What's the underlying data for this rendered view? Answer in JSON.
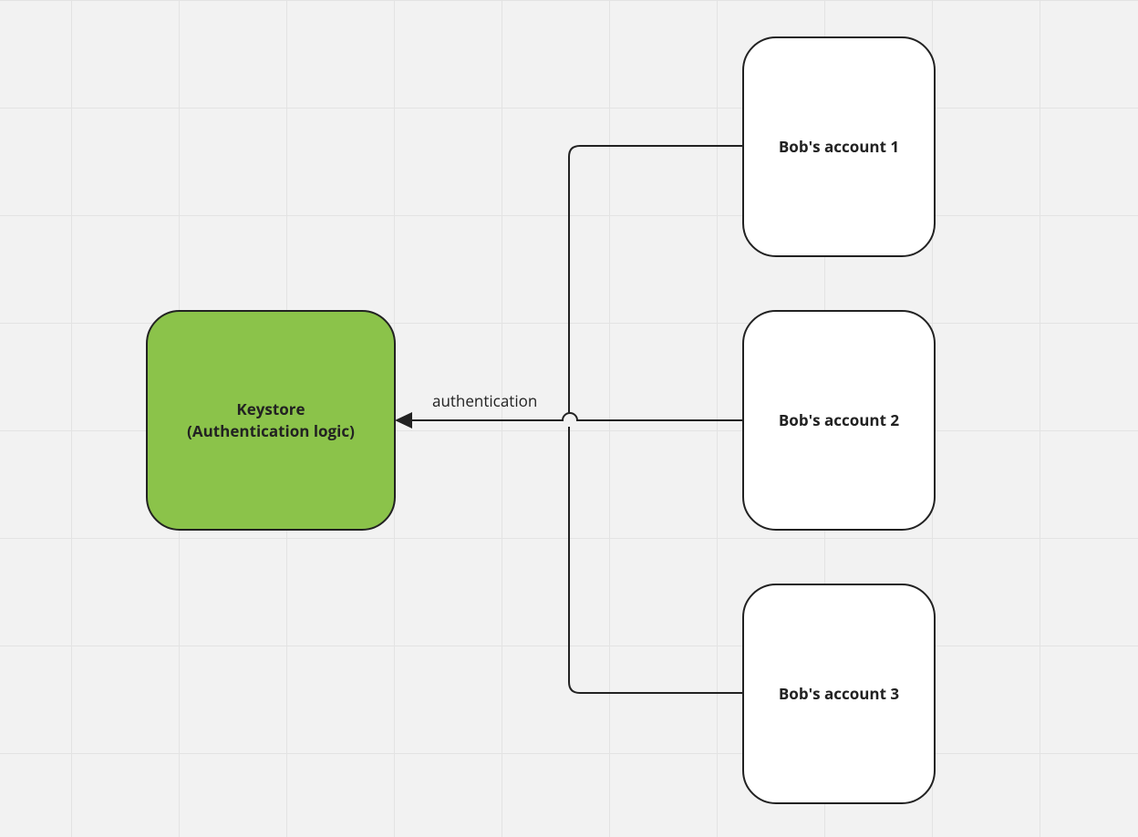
{
  "diagram": {
    "type": "architecture",
    "nodes": {
      "keystore": {
        "line1": "Keystore",
        "line2": "(Authentication logic)",
        "color": "#8bc34a"
      },
      "account1": {
        "label": "Bob's account 1"
      },
      "account2": {
        "label": "Bob's account 2"
      },
      "account3": {
        "label": "Bob's account 3"
      }
    },
    "edges": {
      "auth": {
        "label": "authentication",
        "from": [
          "account1",
          "account2",
          "account3"
        ],
        "to": "keystore"
      }
    }
  }
}
